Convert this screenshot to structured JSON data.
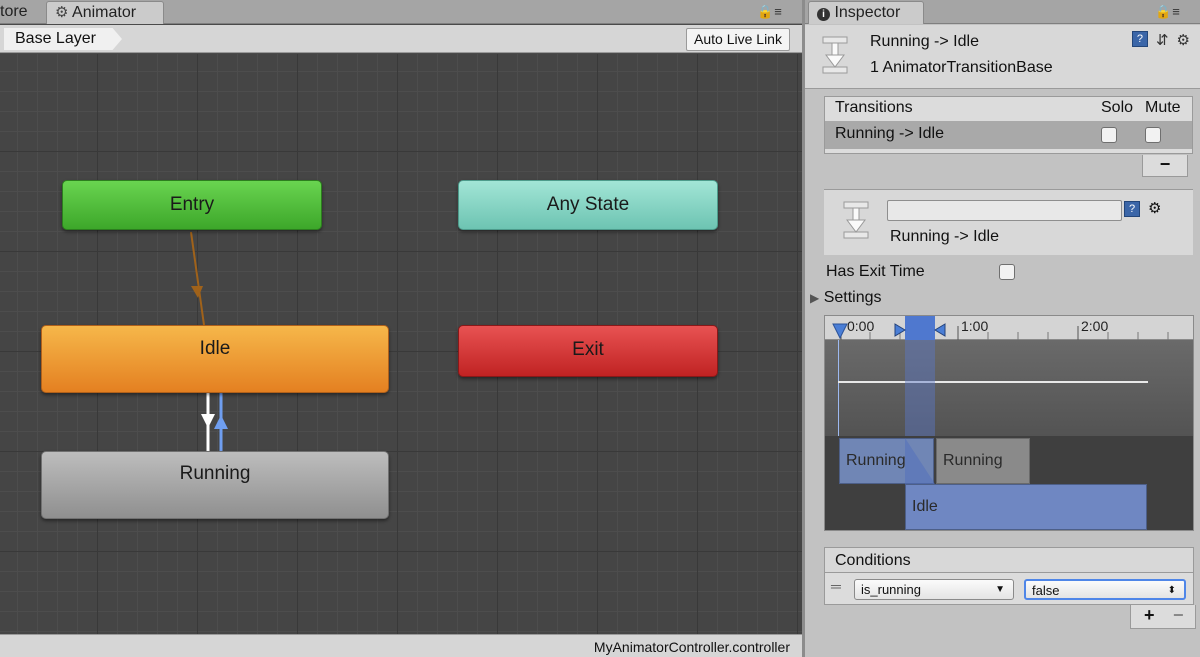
{
  "animator": {
    "tabs": [
      {
        "label": "tore"
      },
      {
        "label": "Animator"
      }
    ],
    "breadcrumb": "Base Layer",
    "auto_live_link": "Auto Live Link",
    "states": {
      "entry": "Entry",
      "any_state": "Any State",
      "idle": "Idle",
      "exit": "Exit",
      "running": "Running"
    },
    "status_file": "MyAnimatorController.controller",
    "colors": {
      "entry": "#4fbf38",
      "any_state": "#86d6c4",
      "idle": "#ec9a35",
      "exit": "#d33a3a",
      "running": "#a6a6a6",
      "entry_link": "#a0621a",
      "selected_link": "#6f9ef0"
    }
  },
  "inspector": {
    "tab_label": "Inspector",
    "header": {
      "title": "Running -> Idle",
      "subtitle": "1 AnimatorTransitionBase"
    },
    "transitions": {
      "header_label": "Transitions",
      "solo_label": "Solo",
      "mute_label": "Mute",
      "rows": [
        {
          "name": "Running -> Idle",
          "solo": false,
          "mute": false
        }
      ],
      "remove_label": "−"
    },
    "detail": {
      "name_value": "",
      "title": "Running -> Idle"
    },
    "has_exit_time_label": "Has Exit Time",
    "has_exit_time": false,
    "settings_label": "Settings",
    "timeline": {
      "ticks": [
        "0:00",
        "1:00",
        "2:00"
      ],
      "clips": {
        "running_1": "Running",
        "running_2": "Running",
        "idle": "Idle"
      }
    },
    "conditions": {
      "header_label": "Conditions",
      "parameter": "is_running",
      "value": "false",
      "add_label": "+",
      "remove_label": "−"
    }
  }
}
